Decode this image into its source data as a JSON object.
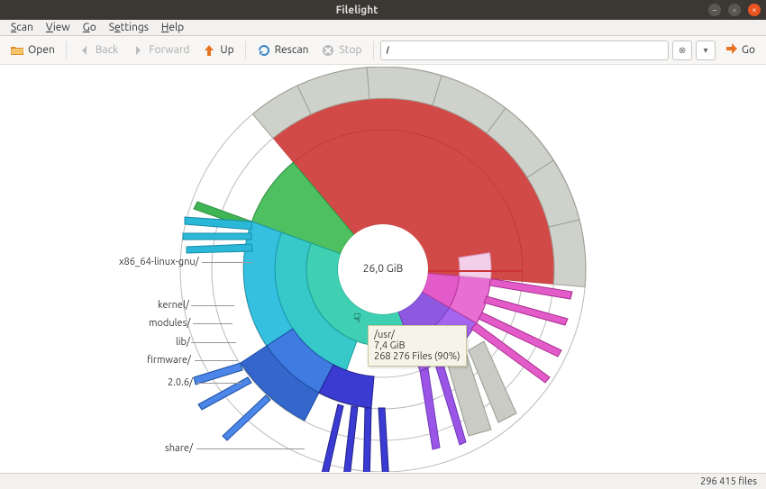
{
  "window": {
    "title": "Filelight"
  },
  "menubar": {
    "scan": "Scan",
    "view": "View",
    "go": "Go",
    "settings": "Settings",
    "help": "Help"
  },
  "toolbar": {
    "open": "Open",
    "back": "Back",
    "forward": "Forward",
    "up": "Up",
    "rescan": "Rescan",
    "stop": "Stop",
    "go": "Go"
  },
  "location": {
    "path": "/"
  },
  "center": {
    "size": "26,0 GiB"
  },
  "tooltip": {
    "path": "/usr/",
    "size": "7,4 GiB",
    "files": "268 276 Files (90%)"
  },
  "labels": {
    "x86": "x86_64-linux-gnu/",
    "kernel": "kernel/",
    "modules": "modules/",
    "lib": "lib/",
    "firmware": "firmware/",
    "ver": "2.0.6/",
    "share": "share/"
  },
  "status": {
    "files": "296 415 files"
  },
  "chart_data": {
    "type": "sunburst",
    "root": {
      "path": "/",
      "size_gib": 26.0
    },
    "hovered": {
      "path": "/usr/",
      "size_gib": 7.4,
      "files": 268276,
      "file_pct": 90
    },
    "visible_labeled_dirs": [
      "x86_64-linux-gnu/",
      "kernel/",
      "modules/",
      "lib/",
      "firmware/",
      "2.0.6/",
      "share/"
    ],
    "notes": "Concentric segmented ring chart of disk usage rooted at /. Outer rings are subdirectories. Color families: red (largest top-level), teal/cyan-green (usr subtree), blue/indigo (lib, kernel, modules, firmware, share), magenta/purple and violet (other large branches), grey/beige outer fragments."
  }
}
